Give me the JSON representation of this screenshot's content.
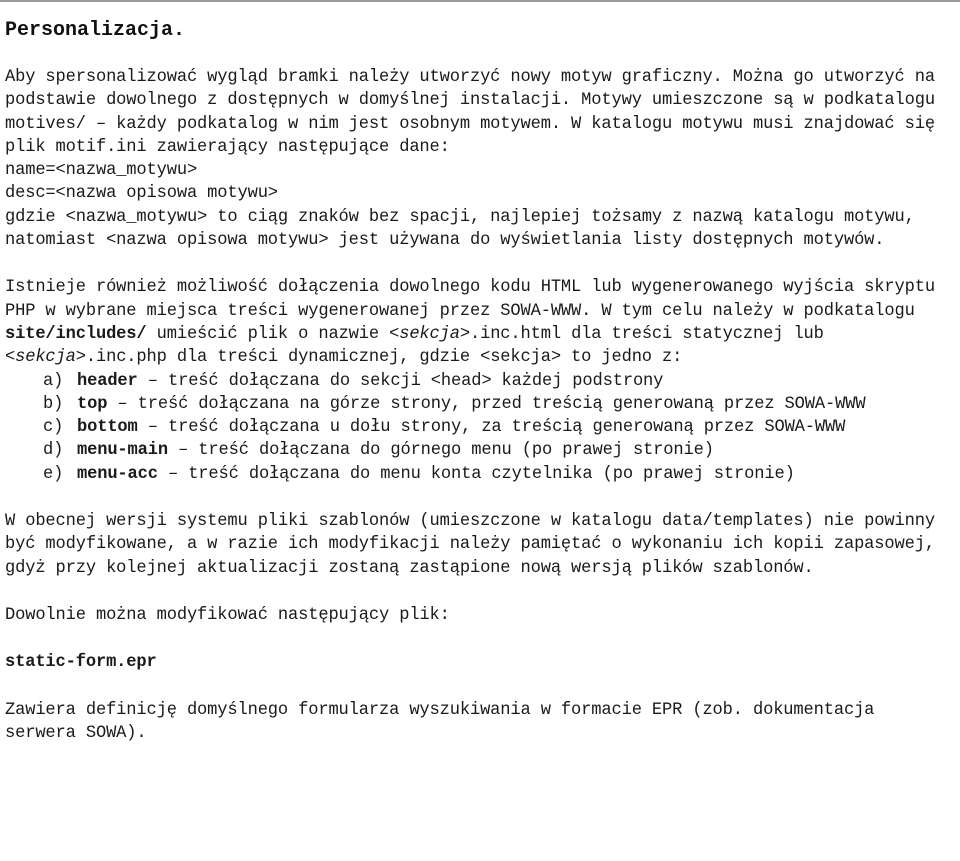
{
  "document": {
    "title": "Personalizacja.",
    "paragraphs": {
      "intro": {
        "seg1": "Aby spersonalizować wygląd bramki należy utworzyć nowy motyw graficzny. Można go utworzyć na podstawie dowolnego z dostępnych w domyślnej instalacji. Motywy umieszczone są w podkatalogu motives/ – każdy podkatalog w nim jest osobnym motywem. W katalogu motywu musi znajdować się plik motif.ini zawierający następujące dane:",
        "line_name": "name=<nazwa_motywu>",
        "line_desc": "desc=<nazwa opisowa motywu>",
        "seg2": "gdzie <nazwa_motywu> to ciąg znaków bez spacji, najlepiej tożsamy z nazwą katalogu motywu, natomiast <nazwa opisowa motywu> jest używana do wyświetlania listy dostępnych motywów."
      },
      "includes": {
        "part1": "Istnieje również możliwość dołączenia dowolnego kodu HTML lub wygenerowanego wyjścia skryptu PHP w wybrane miejsca treści wygenerowanej przez SOWA-WWW. W tym celu należy w podkatalogu ",
        "bold_path": "site/includes/",
        "part2": " umieścić plik o nazwie ",
        "italic_sekcja_1": "<sekcja>",
        "part3": ".inc.html dla treści statycznej lub ",
        "italic_sekcja_2": "<sekcja>",
        "part4": ".inc.php dla treści dynamicznej, gdzie <sekcja> to jedno z:"
      },
      "templates": "W obecnej wersji systemu pliki szablonów (umieszczone w katalogu data/templates) nie powinny być modyfikowane, a w razie ich modyfikacji należy pamiętać o wykonaniu ich kopii zapasowej, gdyż przy kolejnej aktualizacji zostaną zastąpione nową wersją plików szablonów.",
      "modifiable_intro": "Dowolnie można modyfikować następujący plik:",
      "static_form_desc": "Zawiera definicję domyślnego formularza wyszukiwania w formacie EPR (zob. dokumentacja serwera SOWA)."
    },
    "sub_heading": "static-form.epr",
    "section_list": [
      {
        "marker": "a)",
        "name": "header",
        "description": " – treść dołączana do sekcji <head> każdej podstrony"
      },
      {
        "marker": "b)",
        "name": "top",
        "description": " – treść dołączana na górze strony, przed treścią generowaną przez SOWA-WWW"
      },
      {
        "marker": "c)",
        "name": "bottom",
        "description": " – treść dołączana u dołu strony, za treścią generowaną przez SOWA-WWW"
      },
      {
        "marker": "d)",
        "name": "menu-main",
        "description": " – treść dołączana do górnego menu (po prawej stronie)"
      },
      {
        "marker": "e)",
        "name": "menu-acc",
        "description": " – treść dołączana do menu konta czytelnika (po prawej stronie)"
      }
    ]
  },
  "colors": {
    "text": "#1a1a1a",
    "rule": "#9a9a9a",
    "background": "#ffffff"
  }
}
